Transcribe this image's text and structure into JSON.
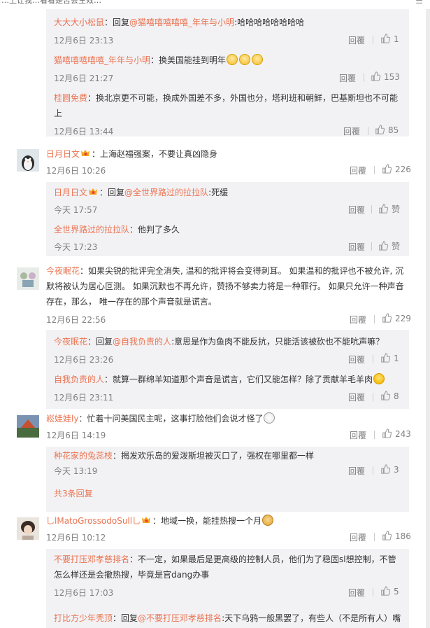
{
  "top": {
    "search_text": "…上让我…看看是否会生效…",
    "menu_label": "☰"
  },
  "labels": {
    "reply": "回覆"
  },
  "blocks": [
    {
      "subs": [
        {
          "user": "大大大小松鼠",
          "sep": "：",
          "prefix": "回复",
          "mention": "@猫嘻嘻嘻嘻嘻_年年与小明",
          "text": ":哈哈哈哈哈哈哈哈",
          "time": "12月6日 23:13",
          "likes": "1"
        },
        {
          "user": "猫嘻嘻嘻嘻嘻_年年与小明",
          "sep": "：",
          "text": "换美国能挂到明年",
          "time": "12月6日 21:27",
          "likes": "153"
        },
        {
          "user": "桂圆免费",
          "sep": "：",
          "text": "换北京更不可能，换成外国差不多，外国也分，塔利班和朝鲜，巴基斯坦也不可能上",
          "time": "12月6日 13:44",
          "likes": "85"
        }
      ]
    },
    {
      "main": {
        "user": "日月日文",
        "sep": "：",
        "text": "上海赵福强案，不要让真凶隐身",
        "time": "12月6日 10:26",
        "likes": "226"
      },
      "subs": [
        {
          "user": "日月日文",
          "sep": "：",
          "prefix": "回复",
          "mention": "@全世界路过的拉拉队",
          "text": ":死缓",
          "time": "今天 17:57",
          "likes": "赞"
        },
        {
          "user": "全世界路过的拉拉队",
          "sep": "：",
          "text": "他判了多久",
          "time": "今天 17:23",
          "likes": "赞"
        }
      ]
    },
    {
      "main": {
        "user": "今夜眠花",
        "sep": "：",
        "text": "如果尖锐的批评完全消失, 温和的批评将会变得刺耳。 如果温和的批评也不被允许, 沉默将被认为居心叵测。 如果沉默也不再允许，赞扬不够卖力将是一种罪行。 如果只允许一种声音存在，那么， 唯一存在的那个声音就是谎言。",
        "time": "12月6日 22:56",
        "likes": "229"
      },
      "subs": [
        {
          "user": "今夜眠花",
          "sep": "：",
          "prefix": "回复",
          "mention": "@自我负责的人",
          "text": ":意思是作为鱼肉不能反抗，只能活该被砍也不能吭声嘛？",
          "time": "12月6日 23:26",
          "likes": "1"
        },
        {
          "user": "自我负责的人",
          "sep": "：",
          "text": "就算一群绵羊知道那个声音是谎言，它们又能怎样？除了贡献羊毛羊肉",
          "time": "12月6日 23:11",
          "likes": "8"
        }
      ]
    },
    {
      "main": {
        "user": "崧娃娃ly",
        "sep": "：",
        "text": "忙着十问美国民主呢，这事打脸他们会说才怪了",
        "time": "12月6日 14:19",
        "likes": "243"
      },
      "subs": [
        {
          "user": "种花家的兔蕊枝",
          "sep": "：",
          "text": "揭发欢乐岛的爱泼斯坦被灭口了，强权在哪里都一样",
          "time": "今天 13:19",
          "likes": "3"
        }
      ],
      "more": "共3条回复"
    },
    {
      "main": {
        "user": "乚lMatoGrossodoSull乚",
        "sep": "：",
        "text": "地域一换，能挂热搜一个月",
        "time": "12月6日 10:12",
        "likes": "186"
      },
      "subs": [
        {
          "user": "不要打压邓孝慈排名",
          "sep": "：",
          "text": "不一定，如果最后是更高级的控制人员，他们为了稳固sl想控制，不管怎么样还是会撤热搜，毕竟是官dang办事",
          "time": "12月6日 17:03",
          "likes": "5"
        },
        {
          "user": "打比方少年秃顶",
          "sep": "：",
          "prefix": "回复",
          "mention": "@不要打压邓孝慈排名",
          "text": ":天下乌鸦一般黑罢了，有些人（不是所有人）嘴里是主义，心里全是生意，真正的理想者又有多少呢",
          "time": "",
          "likes": ""
        }
      ]
    }
  ],
  "colors": {
    "accent": "#eb7350",
    "meta": "#808080",
    "sub_bg": "#f2f2f5"
  },
  "icons": {
    "like": "thumbs-up-icon",
    "vip": "vip-badge-icon",
    "menu": "menu-icon"
  }
}
